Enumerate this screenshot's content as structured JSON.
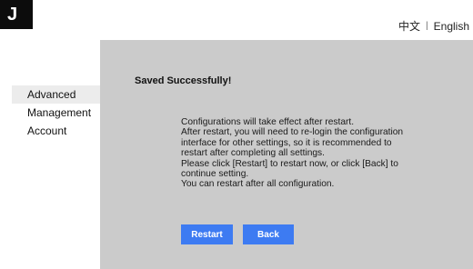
{
  "logo": {
    "text": "J"
  },
  "language": {
    "chinese": "中文",
    "separator": "|",
    "english": "English"
  },
  "sidebar": {
    "items": [
      {
        "label": "Advanced",
        "active": true
      },
      {
        "label": "Management",
        "active": false
      },
      {
        "label": "Account",
        "active": false
      }
    ]
  },
  "main": {
    "status": "Saved Successfully!",
    "message_lines": [
      "Configurations will take effect after restart.",
      "After restart, you will need to re-login the configuration",
      "interface for other settings, so it is recommended to",
      "restart after completing all settings.",
      "Please click [Restart] to restart now, or click [Back] to",
      "continue setting.",
      "You can restart after all configuration."
    ],
    "buttons": {
      "restart": "Restart",
      "back": "Back"
    }
  },
  "colors": {
    "panel": "#cbcbcb",
    "button": "#3d7bf2",
    "logo_bg": "#0c0c0c",
    "active_item": "#ececec"
  }
}
